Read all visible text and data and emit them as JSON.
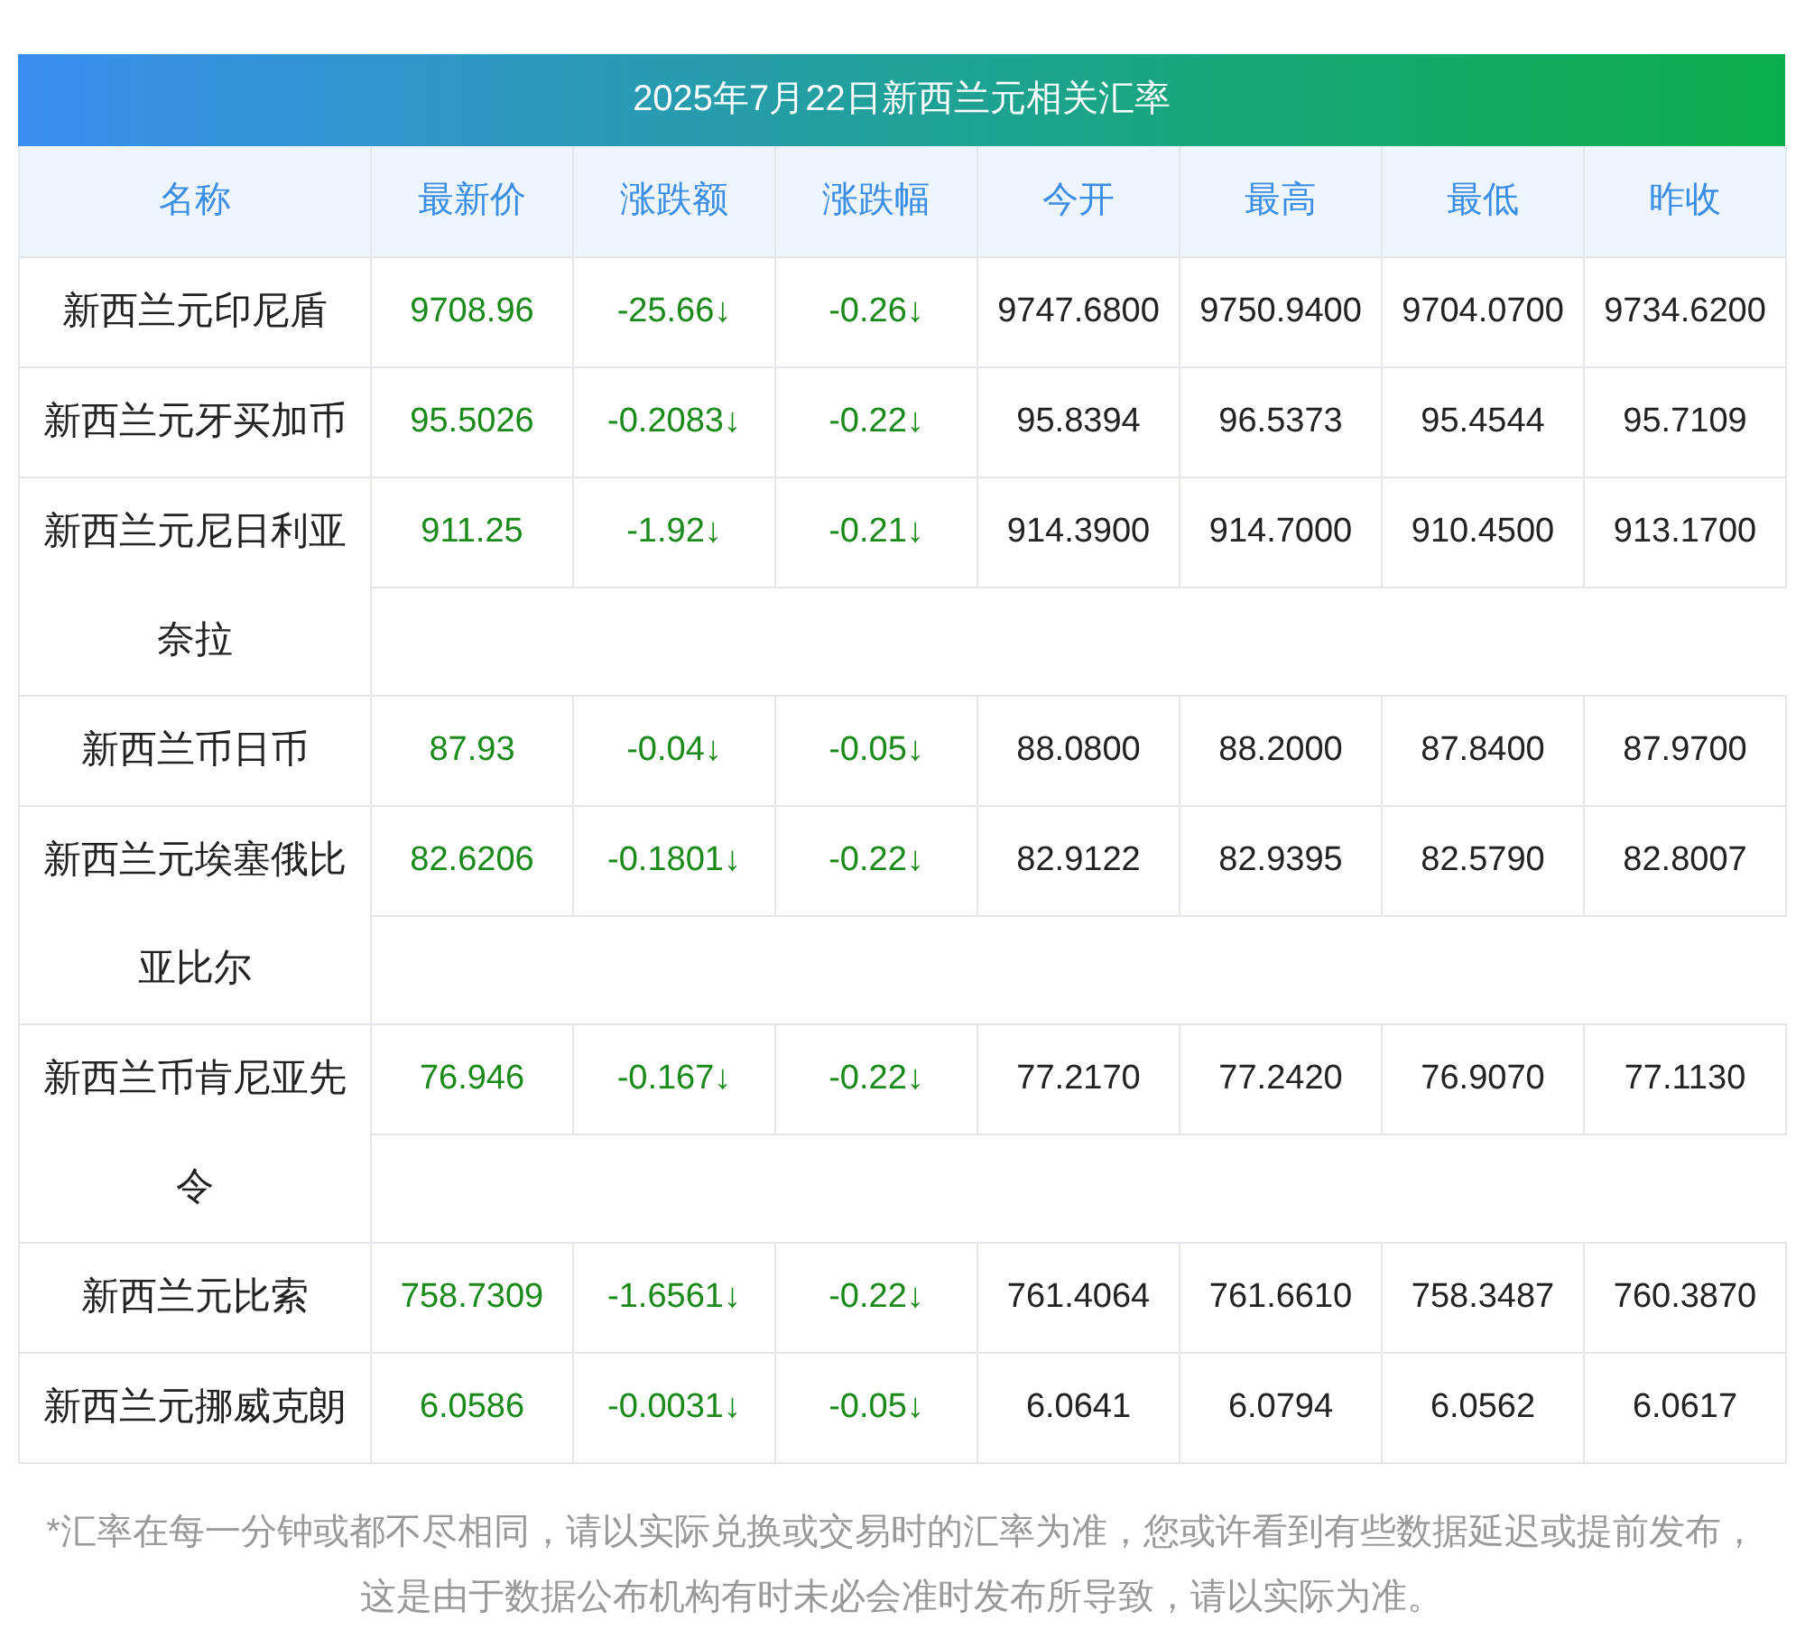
{
  "title": "2025年7月22日新西兰元相关汇率",
  "columns": [
    "名称",
    "最新价",
    "涨跌额",
    "涨跌幅",
    "今开",
    "最高",
    "最低",
    "昨收"
  ],
  "rows": [
    {
      "name": "新西兰元印尼盾",
      "color": "#1a8a1a",
      "latest": "9708.96",
      "change": "-25.66↓",
      "change_pct": "-0.26↓",
      "open": "9747.6800",
      "high": "9750.9400",
      "low": "9704.0700",
      "prev_close": "9734.6200"
    },
    {
      "name": "新西兰元牙买加币",
      "color": "#1a8a1a",
      "latest": "95.5026",
      "change": "-0.2083↓",
      "change_pct": "-0.22↓",
      "open": "95.8394",
      "high": "96.5373",
      "low": "95.4544",
      "prev_close": "95.7109"
    },
    {
      "name": "新西兰元尼日利亚奈拉",
      "color": "#1a8a1a",
      "latest": "911.25",
      "change": "-1.92↓",
      "change_pct": "-0.21↓",
      "open": "914.3900",
      "high": "914.7000",
      "low": "910.4500",
      "prev_close": "913.1700"
    },
    {
      "name": "新西兰币日币",
      "color": "#1a8a1a",
      "latest": "87.93",
      "change": "-0.04↓",
      "change_pct": "-0.05↓",
      "open": "88.0800",
      "high": "88.2000",
      "low": "87.8400",
      "prev_close": "87.9700"
    },
    {
      "name": "新西兰元埃塞俄比亚比尔",
      "color": "#1a8a1a",
      "latest": "82.6206",
      "change": "-0.1801↓",
      "change_pct": "-0.22↓",
      "open": "82.9122",
      "high": "82.9395",
      "low": "82.5790",
      "prev_close": "82.8007"
    },
    {
      "name": "新西兰币肯尼亚先令",
      "color": "#1a8a1a",
      "latest": "76.946",
      "change": "-0.167↓",
      "change_pct": "-0.22↓",
      "open": "77.2170",
      "high": "77.2420",
      "low": "76.9070",
      "prev_close": "77.1130"
    },
    {
      "name": "新西兰元比索",
      "color": "#1a8a1a",
      "latest": "758.7309",
      "change": "-1.6561↓",
      "change_pct": "-0.22↓",
      "open": "761.4064",
      "high": "761.6610",
      "low": "758.3487",
      "prev_close": "760.3870"
    },
    {
      "name": "新西兰元挪威克朗",
      "color": "#1a8a1a",
      "latest": "6.0586",
      "change": "-0.0031↓",
      "change_pct": "-0.05↓",
      "open": "6.0641",
      "high": "6.0794",
      "low": "6.0562",
      "prev_close": "6.0617"
    }
  ],
  "footnote": "*汇率在每一分钟或都不尽相同，请以实际兑换或交易时的汇率为准，您或许看到有些数据延迟或提前发布，这是由于数据公布机构有时未必会准时发布所导致，请以实际为准。"
}
